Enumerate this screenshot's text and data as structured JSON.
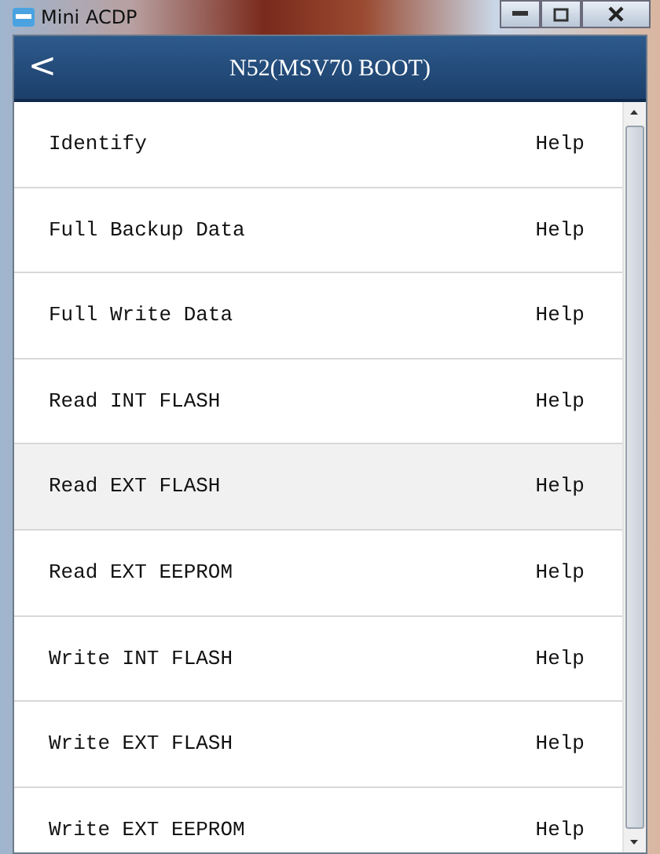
{
  "window": {
    "title": "Mini ACDP"
  },
  "header": {
    "back": "<",
    "title": "N52(MSV70 BOOT)"
  },
  "items": [
    {
      "label": "Identify",
      "action": "Help",
      "selected": false
    },
    {
      "label": "Full Backup Data",
      "action": "Help",
      "selected": false
    },
    {
      "label": "Full Write Data",
      "action": "Help",
      "selected": false
    },
    {
      "label": "Read INT FLASH",
      "action": "Help",
      "selected": false
    },
    {
      "label": "Read EXT FLASH",
      "action": "Help",
      "selected": true
    },
    {
      "label": "Read EXT EEPROM",
      "action": "Help",
      "selected": false
    },
    {
      "label": "Write INT FLASH",
      "action": "Help",
      "selected": false
    },
    {
      "label": "Write EXT FLASH",
      "action": "Help",
      "selected": false
    },
    {
      "label": "Write EXT EEPROM",
      "action": "Help",
      "selected": false
    }
  ]
}
